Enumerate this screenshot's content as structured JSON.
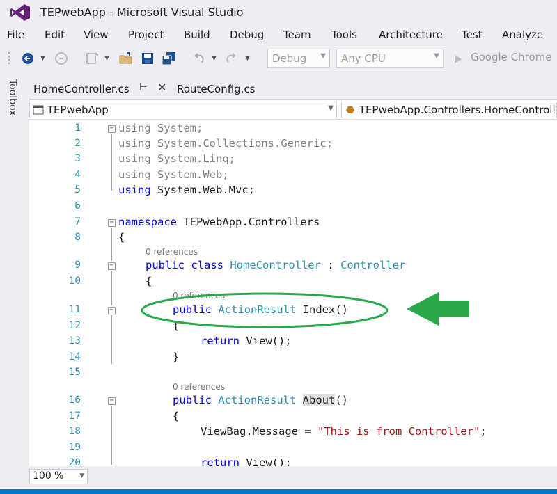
{
  "window": {
    "title": "TEPwebApp - Microsoft Visual Studio"
  },
  "menu": [
    "File",
    "Edit",
    "View",
    "Project",
    "Build",
    "Debug",
    "Team",
    "Tools",
    "Architecture",
    "Test",
    "Analyze"
  ],
  "toolbar": {
    "config": "Debug",
    "platform": "Any CPU",
    "run_target": "Google Chrome"
  },
  "toolbox_label": "Toolbox",
  "tabs": [
    {
      "label": "HomeController.cs",
      "active": true
    },
    {
      "label": "RouteConfig.cs",
      "active": false
    }
  ],
  "nav": {
    "project": "TEPwebApp",
    "member": "TEPwebApp.Controllers.HomeController"
  },
  "editor": {
    "line_numbers": [
      "1",
      "2",
      "3",
      "4",
      "5",
      "6",
      "7",
      "8",
      "9",
      "10",
      "11",
      "12",
      "13",
      "14",
      "15",
      "16",
      "17",
      "18",
      "19",
      "20"
    ],
    "codelens": [
      "0 references",
      "0 references",
      "0 references"
    ],
    "lines": {
      "l1": {
        "kw": "using",
        "rest": " System;"
      },
      "l2": {
        "kw": "using",
        "rest": " System.Collections.Generic;"
      },
      "l3": {
        "kw": "using",
        "rest": " System.Linq;"
      },
      "l4": {
        "kw": "using",
        "rest": " System.Web;"
      },
      "l5": {
        "kw": "using",
        "rest": " System.Web.Mvc;"
      },
      "l7": {
        "kw": "namespace",
        "rest": " TEPwebApp.Controllers"
      },
      "l8": "{",
      "l9": {
        "kw": "public class",
        "type": "HomeController",
        "sep": " : ",
        "base": "Controller"
      },
      "l10": "{",
      "l11": {
        "kw": "public",
        "type": "ActionResult",
        "name": " Index()"
      },
      "l12": "{",
      "l13": {
        "kw": "return",
        "rest": " View();"
      },
      "l14": "}",
      "l16": {
        "kw": "public",
        "type": "ActionResult",
        "name": "About",
        "paren": "()"
      },
      "l17": "{",
      "l18": {
        "pre": "ViewBag.Message = ",
        "str": "\"This is from Controller\"",
        "post": ";"
      },
      "l20": {
        "kw": "return",
        "rest": " View();"
      }
    }
  },
  "zoom": "100 %",
  "colors": {
    "keyword": "#0000ff",
    "type": "#2b91af",
    "string": "#a31515",
    "annotation": "#2aa84a",
    "accent": "#007acc"
  }
}
